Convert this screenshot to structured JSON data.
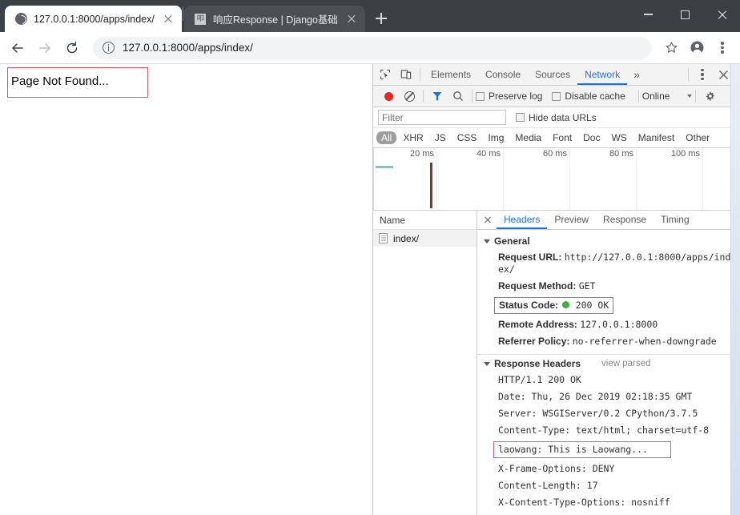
{
  "window": {
    "controls": {
      "minimize": "minimize-button",
      "maximize": "maximize-button",
      "close": "close-button"
    }
  },
  "tabs": [
    {
      "title": "127.0.0.1:8000/apps/index/",
      "favicon": "globe-icon",
      "active": true
    },
    {
      "title": "响应Response | Django基础",
      "favicon": "document-icon",
      "active": false
    }
  ],
  "newtab_label": "+",
  "toolbar": {
    "back_icon": "back-arrow-icon",
    "forward_icon": "forward-arrow-icon",
    "reload_icon": "reload-icon",
    "info_icon": "info-circle-icon",
    "url": "127.0.0.1:8000/apps/index/",
    "url_host": "127.0.0.1",
    "url_rest": ":8000/apps/index/",
    "bookmark_icon": "star-icon",
    "profile_icon": "profile-avatar-icon",
    "menu_icon": "three-dot-menu-icon"
  },
  "page": {
    "body_text": "Page Not Found..."
  },
  "devtools": {
    "inspect_icon": "inspect-element-icon",
    "device_icon": "device-toolbar-icon",
    "tabs": [
      {
        "label": "Elements",
        "active": false
      },
      {
        "label": "Console",
        "active": false
      },
      {
        "label": "Sources",
        "active": false
      },
      {
        "label": "Network",
        "active": true
      }
    ],
    "more_tabs": "»",
    "menu_icon": "devtools-menu-icon",
    "close_icon": "devtools-close-icon",
    "network_toolbar": {
      "record_icon": "record-button",
      "clear_icon": "clear-button",
      "filter_icon": "filter-icon",
      "search_icon": "search-icon",
      "preserve_log": "Preserve log",
      "disable_cache": "Disable cache",
      "throttle": "Online",
      "settings_icon": "settings-gear-icon"
    },
    "filter": {
      "placeholder": "Filter",
      "value": "",
      "hide_data_urls": "Hide data URLs"
    },
    "types": [
      {
        "label": "All",
        "active": true
      },
      {
        "label": "XHR",
        "active": false
      },
      {
        "label": "JS",
        "active": false
      },
      {
        "label": "CSS",
        "active": false
      },
      {
        "label": "Img",
        "active": false
      },
      {
        "label": "Media",
        "active": false
      },
      {
        "label": "Font",
        "active": false
      },
      {
        "label": "Doc",
        "active": false
      },
      {
        "label": "WS",
        "active": false
      },
      {
        "label": "Manifest",
        "active": false
      },
      {
        "label": "Other",
        "active": false
      }
    ],
    "overview": {
      "ticks": [
        "20 ms",
        "40 ms",
        "60 ms",
        "80 ms",
        "100 ms"
      ],
      "bar_color": "#6fd0c0",
      "dom_event_color": "#2b6cd4",
      "load_event_color": "#8a2b2b"
    },
    "requests": {
      "column_header": "Name",
      "rows": [
        {
          "name": "index/",
          "icon": "document-icon",
          "selected": true
        }
      ]
    },
    "detail": {
      "close_icon": "detail-close-icon",
      "tabs": [
        {
          "label": "Headers",
          "active": true
        },
        {
          "label": "Preview",
          "active": false
        },
        {
          "label": "Response",
          "active": false
        },
        {
          "label": "Timing",
          "active": false
        }
      ],
      "general": {
        "title": "General",
        "rows": [
          {
            "key": "Request URL:",
            "value": "http://127.0.0.1:8000/apps/index/",
            "highlight": false
          },
          {
            "key": "Request Method:",
            "value": "GET",
            "highlight": false
          },
          {
            "key": "Status Code:",
            "value": "200 OK",
            "status_dot": "#3fae3f",
            "highlight": true
          },
          {
            "key": "Remote Address:",
            "value": "127.0.0.1:8000",
            "highlight": false
          },
          {
            "key": "Referrer Policy:",
            "value": "no-referrer-when-downgrade",
            "highlight": false
          }
        ]
      },
      "response_headers": {
        "title": "Response Headers",
        "view_parsed": "view parsed",
        "rows": [
          {
            "text": "HTTP/1.1 200 OK",
            "highlight": false
          },
          {
            "text": "Date: Thu, 26 Dec 2019 02:18:35 GMT",
            "highlight": false
          },
          {
            "text": "Server: WSGIServer/0.2 CPython/3.7.5",
            "highlight": false
          },
          {
            "text": "Content-Type: text/html; charset=utf-8",
            "highlight": false
          },
          {
            "text": "laowang: This is Laowang...",
            "highlight": true
          },
          {
            "text": "X-Frame-Options: DENY",
            "highlight": false
          },
          {
            "text": "Content-Length: 17",
            "highlight": false
          },
          {
            "text": "X-Content-Type-Options: nosniff",
            "highlight": false
          }
        ]
      }
    }
  },
  "colors": {
    "accent": "#1a73e8",
    "annotation": "#c9606a",
    "status_ok": "#3fae3f",
    "titlebar": "#3b4045"
  }
}
